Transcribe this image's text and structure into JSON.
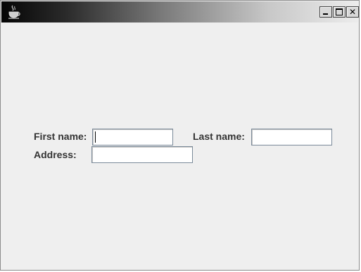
{
  "window": {
    "title": "",
    "controls": {
      "minimize_icon": "minimize-icon",
      "maximize_icon": "maximize-icon",
      "close_icon": "close-icon"
    }
  },
  "form": {
    "first_name": {
      "label": "First name:",
      "value": ""
    },
    "last_name": {
      "label": "Last name:",
      "value": ""
    },
    "address": {
      "label": "Address:",
      "value": ""
    }
  }
}
